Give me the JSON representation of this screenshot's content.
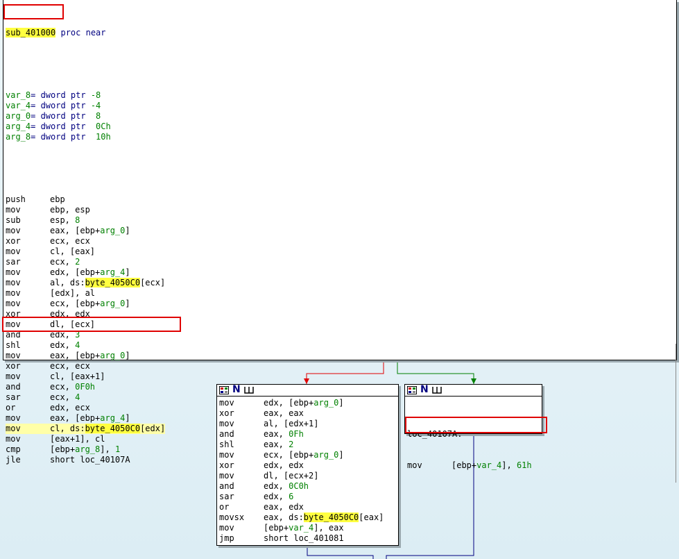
{
  "main_block": {
    "func_name": "sub_401000",
    "func_decl": " proc near",
    "vars": [
      {
        "name": "var_8",
        "decl": "= dword ptr ",
        "value": "-8"
      },
      {
        "name": "var_4",
        "decl": "= dword ptr ",
        "value": "-4"
      },
      {
        "name": "arg_0",
        "decl": "= dword ptr ",
        "value": " 8"
      },
      {
        "name": "arg_4",
        "decl": "= dword ptr ",
        "value": " 0Ch"
      },
      {
        "name": "arg_8",
        "decl": "= dword ptr ",
        "value": " 10h"
      }
    ],
    "lines": [
      {
        "m": "push",
        "o": [
          [
            "ebp",
            ""
          ]
        ]
      },
      {
        "m": "mov",
        "o": [
          [
            "ebp, esp",
            ""
          ]
        ]
      },
      {
        "m": "sub",
        "o": [
          [
            "esp, ",
            ""
          ],
          [
            "8",
            "num"
          ]
        ]
      },
      {
        "m": "mov",
        "o": [
          [
            "eax, [ebp+",
            ""
          ],
          [
            "arg_0",
            "var"
          ],
          [
            "]",
            ""
          ]
        ]
      },
      {
        "m": "xor",
        "o": [
          [
            "ecx, ecx",
            ""
          ]
        ]
      },
      {
        "m": "mov",
        "o": [
          [
            "cl, [eax]",
            ""
          ]
        ]
      },
      {
        "m": "sar",
        "o": [
          [
            "ecx, ",
            ""
          ],
          [
            "2",
            "num"
          ]
        ]
      },
      {
        "m": "mov",
        "o": [
          [
            "edx, [ebp+",
            ""
          ],
          [
            "arg_4",
            "var"
          ],
          [
            "]",
            ""
          ]
        ]
      },
      {
        "m": "mov",
        "o": [
          [
            "al, ds:",
            ""
          ],
          [
            "byte_4050C0",
            "hl"
          ],
          [
            "[ecx]",
            ""
          ]
        ]
      },
      {
        "m": "mov",
        "o": [
          [
            "[edx], al",
            ""
          ]
        ]
      },
      {
        "m": "mov",
        "o": [
          [
            "ecx, [ebp+",
            ""
          ],
          [
            "arg_0",
            "var"
          ],
          [
            "]",
            ""
          ]
        ]
      },
      {
        "m": "xor",
        "o": [
          [
            "edx, edx",
            ""
          ]
        ]
      },
      {
        "m": "mov",
        "o": [
          [
            "dl, [ecx]",
            ""
          ]
        ]
      },
      {
        "m": "and",
        "o": [
          [
            "edx, ",
            ""
          ],
          [
            "3",
            "num"
          ]
        ]
      },
      {
        "m": "shl",
        "o": [
          [
            "edx, ",
            ""
          ],
          [
            "4",
            "num"
          ]
        ]
      },
      {
        "m": "mov",
        "o": [
          [
            "eax, [ebp+",
            ""
          ],
          [
            "arg_0",
            "var"
          ],
          [
            "]",
            ""
          ]
        ]
      },
      {
        "m": "xor",
        "o": [
          [
            "ecx, ecx",
            ""
          ]
        ]
      },
      {
        "m": "mov",
        "o": [
          [
            "cl, [eax+1]",
            ""
          ]
        ]
      },
      {
        "m": "and",
        "o": [
          [
            "ecx, ",
            ""
          ],
          [
            "0F0h",
            "num"
          ]
        ]
      },
      {
        "m": "sar",
        "o": [
          [
            "ecx, ",
            ""
          ],
          [
            "4",
            "num"
          ]
        ]
      },
      {
        "m": "or",
        "o": [
          [
            "edx, ecx",
            ""
          ]
        ]
      },
      {
        "m": "mov",
        "o": [
          [
            "eax, [ebp+",
            ""
          ],
          [
            "arg_4",
            "var"
          ],
          [
            "]",
            ""
          ]
        ]
      },
      {
        "m": "mov",
        "o": [
          [
            "cl, ds:",
            ""
          ],
          [
            "byte_4050C0",
            "hl"
          ],
          [
            "[edx]",
            ""
          ]
        ],
        "current": true
      },
      {
        "m": "mov",
        "o": [
          [
            "[eax+1], cl",
            ""
          ]
        ]
      },
      {
        "m": "cmp",
        "o": [
          [
            "[ebp+",
            ""
          ],
          [
            "arg_8",
            "var"
          ],
          [
            "], ",
            ""
          ],
          [
            "1",
            "num"
          ]
        ]
      },
      {
        "m": "jle",
        "o": [
          [
            "short loc_40107A",
            ""
          ]
        ]
      }
    ]
  },
  "left_block": {
    "lines": [
      {
        "m": "mov",
        "o": [
          [
            "edx, [ebp+",
            ""
          ],
          [
            "arg_0",
            "var"
          ],
          [
            "]",
            ""
          ]
        ]
      },
      {
        "m": "xor",
        "o": [
          [
            "eax, eax",
            ""
          ]
        ]
      },
      {
        "m": "mov",
        "o": [
          [
            "al, [edx+1]",
            ""
          ]
        ]
      },
      {
        "m": "and",
        "o": [
          [
            "eax, ",
            ""
          ],
          [
            "0Fh",
            "num"
          ]
        ]
      },
      {
        "m": "shl",
        "o": [
          [
            "eax, ",
            ""
          ],
          [
            "2",
            "num"
          ]
        ]
      },
      {
        "m": "mov",
        "o": [
          [
            "ecx, [ebp+",
            ""
          ],
          [
            "arg_0",
            "var"
          ],
          [
            "]",
            ""
          ]
        ]
      },
      {
        "m": "xor",
        "o": [
          [
            "edx, edx",
            ""
          ]
        ]
      },
      {
        "m": "mov",
        "o": [
          [
            "dl, [ecx+2]",
            ""
          ]
        ]
      },
      {
        "m": "and",
        "o": [
          [
            "edx, ",
            ""
          ],
          [
            "0C0h",
            "num"
          ]
        ]
      },
      {
        "m": "sar",
        "o": [
          [
            "edx, ",
            ""
          ],
          [
            "6",
            "num"
          ]
        ]
      },
      {
        "m": "or",
        "o": [
          [
            "eax, edx",
            ""
          ]
        ]
      },
      {
        "m": "movsx",
        "o": [
          [
            "eax, ds:",
            ""
          ],
          [
            "byte_4050C0",
            "hl"
          ],
          [
            "[eax]",
            ""
          ]
        ]
      },
      {
        "m": "mov",
        "o": [
          [
            "[ebp+",
            ""
          ],
          [
            "var_4",
            "var"
          ],
          [
            "], eax",
            ""
          ]
        ]
      },
      {
        "m": "jmp",
        "o": [
          [
            "short loc_401081",
            ""
          ]
        ]
      }
    ]
  },
  "right_block": {
    "label": "loc_40107A:",
    "lines": [
      {
        "m": "mov",
        "o": [
          [
            "[ebp+",
            ""
          ],
          [
            "var_4",
            "var"
          ],
          [
            "], ",
            ""
          ],
          [
            "61h",
            "num"
          ]
        ]
      }
    ]
  },
  "colors": {
    "highlight": "#ffff40",
    "redbox": "#e00000",
    "green_edge": "#008000",
    "red_edge": "#e00000",
    "blue_edge": "#000080"
  },
  "icons": [
    "graph-node-grid-icon",
    "graph-node-n-icon",
    "graph-node-flow-icon"
  ]
}
